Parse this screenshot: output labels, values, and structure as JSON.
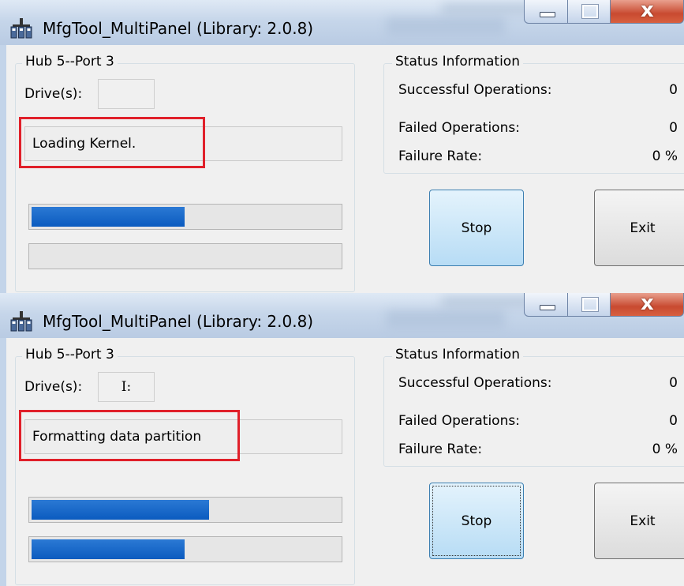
{
  "windows": [
    {
      "title": "MfgTool_MultiPanel (Library: 2.0.8)",
      "hub_label": "Hub 5--Port 3",
      "drive_label": "Drive(s):",
      "drive_value": "",
      "status_message": "Loading Kernel.",
      "progress_top": 0.5,
      "progress_bottom": 0,
      "status_group_label": "Status Information",
      "successful_label": "Successful Operations:",
      "successful_value": "0",
      "failed_label": "Failed Operations:",
      "failed_value": "0",
      "failure_rate_label": "Failure Rate:",
      "failure_rate_value": "0 %",
      "stop_label": "Stop",
      "exit_label": "Exit"
    },
    {
      "title": "MfgTool_MultiPanel (Library: 2.0.8)",
      "hub_label": "Hub 5--Port 3",
      "drive_label": "Drive(s):",
      "drive_value": "I:",
      "status_message": "Formatting data partition",
      "progress_top": 0.58,
      "progress_bottom": 0.5,
      "status_group_label": "Status Information",
      "successful_label": "Successful Operations:",
      "successful_value": "0",
      "failed_label": "Failed Operations:",
      "failed_value": "0",
      "failure_rate_label": "Failure Rate:",
      "failure_rate_value": "0 %",
      "stop_label": "Stop",
      "exit_label": "Exit"
    }
  ],
  "icons": {
    "app": "usb-hub-icon",
    "minimize": "minimize-icon",
    "maximize": "maximize-icon",
    "close": "close-icon"
  },
  "colors": {
    "progress_fill": "#0b5bbf",
    "highlight": "#e0202a",
    "titlebar": "#c6d6ea",
    "close_button": "#c84a30"
  }
}
